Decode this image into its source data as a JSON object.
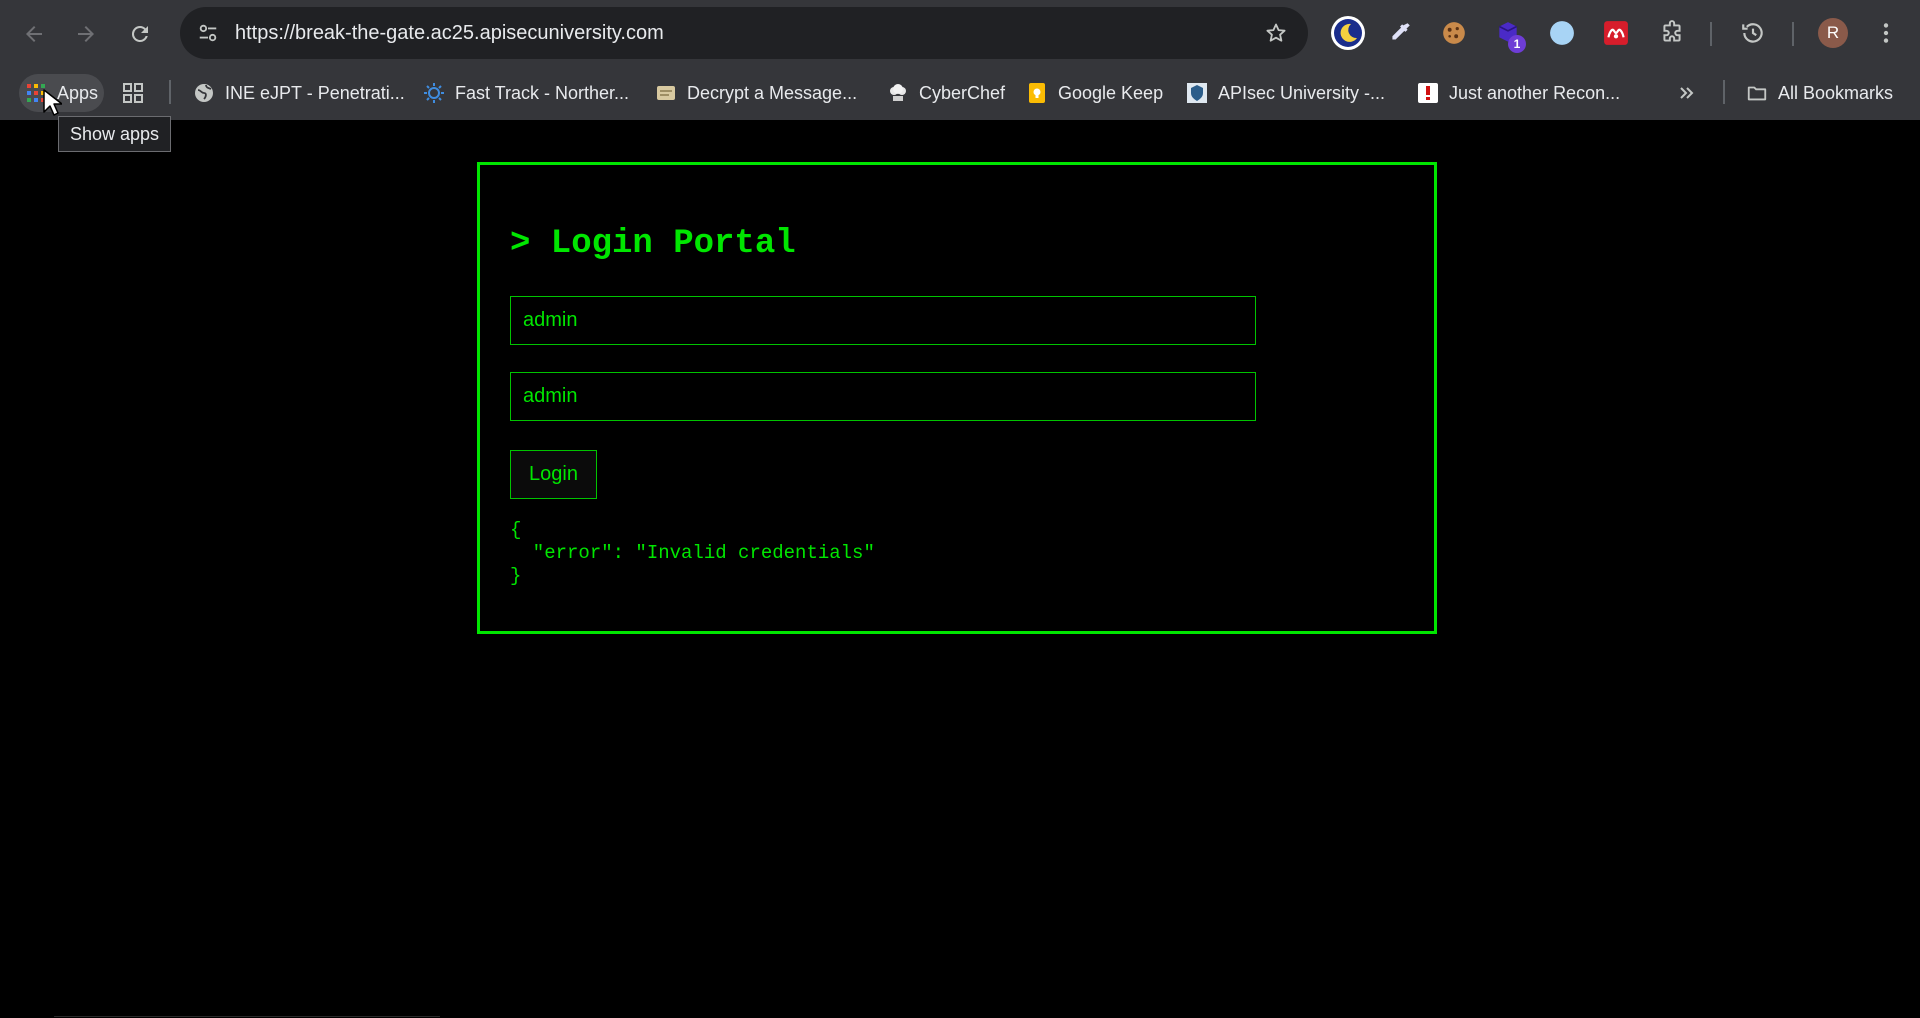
{
  "browser": {
    "url": "https://break-the-gate.ac25.apisecuniversity.com",
    "profile_initial": "R",
    "extension_badge": "1"
  },
  "bookmarks": {
    "apps_label": "Apps",
    "items": [
      {
        "label": "INE eJPT - Penetrati...",
        "icon": "globe-icon"
      },
      {
        "label": "Fast Track - Norther...",
        "icon": "sun-gear-icon"
      },
      {
        "label": "Decrypt a Message...",
        "icon": "scroll-icon"
      },
      {
        "label": "CyberChef",
        "icon": "chef-hat-icon"
      },
      {
        "label": "Google Keep",
        "icon": "keep-icon"
      },
      {
        "label": "APIsec University -...",
        "icon": "apisec-icon"
      },
      {
        "label": "Just another Recon...",
        "icon": "exclamation-icon"
      }
    ],
    "all_bookmarks_label": "All Bookmarks",
    "tooltip": "Show apps"
  },
  "page": {
    "title": "> Login Portal",
    "username_value": "admin",
    "password_value": "admin",
    "login_button": "Login",
    "response": "{\n  \"error\": \"Invalid credentials\"\n}"
  },
  "colors": {
    "accent": "#00e600",
    "background": "#000000",
    "chrome": "#35363a"
  }
}
